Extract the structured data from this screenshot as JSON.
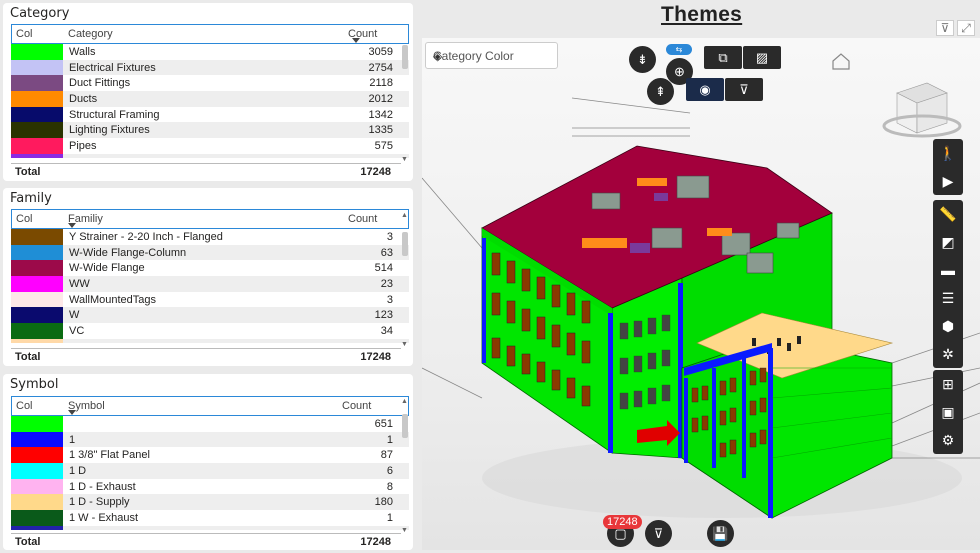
{
  "category": {
    "title": "Category",
    "headers": {
      "col": "Col",
      "name": "Category",
      "count": "Count"
    },
    "rows": [
      {
        "color": "#00ff00",
        "name": "Walls",
        "count": "3059"
      },
      {
        "color": "#c3c3f5",
        "name": "Electrical Fixtures",
        "count": "2754"
      },
      {
        "color": "#7b4a82",
        "name": "Duct Fittings",
        "count": "2118"
      },
      {
        "color": "#ff8a00",
        "name": "Ducts",
        "count": "2012"
      },
      {
        "color": "#070b6b",
        "name": "Structural Framing",
        "count": "1342"
      },
      {
        "color": "#2a3300",
        "name": "Lighting Fixtures",
        "count": "1335"
      },
      {
        "color": "#ff1a5e",
        "name": "Pipes",
        "count": "575"
      },
      {
        "color": "#8a2be2",
        "name": "",
        "count": ""
      }
    ],
    "total_label": "Total",
    "total": "17248"
  },
  "family": {
    "title": "Family",
    "headers": {
      "col": "Col",
      "name": "Familiy",
      "count": "Count"
    },
    "rows": [
      {
        "color": "#7a4a00",
        "name": "Y Strainer - 2-20 Inch - Flanged",
        "count": "3"
      },
      {
        "color": "#1f8ed6",
        "name": "W-Wide Flange-Column",
        "count": "63"
      },
      {
        "color": "#9c0a4a",
        "name": "W-Wide Flange",
        "count": "514"
      },
      {
        "color": "#ff00ff",
        "name": "WW",
        "count": "23"
      },
      {
        "color": "#fde8e8",
        "name": "WallMountedTags",
        "count": "3"
      },
      {
        "color": "#0a0a6e",
        "name": "W",
        "count": "123"
      },
      {
        "color": "#0a6b12",
        "name": "VC",
        "count": "34"
      },
      {
        "color": "#ffd9a8",
        "name": "",
        "count": ""
      }
    ],
    "total_label": "Total",
    "total": "17248"
  },
  "symbol": {
    "title": "Symbol",
    "headers": {
      "col": "Col",
      "name": "Symbol",
      "count": "Count"
    },
    "rows": [
      {
        "color": "#00ff00",
        "name": "",
        "count": "651"
      },
      {
        "color": "#0a0aff",
        "name": "1",
        "count": "1"
      },
      {
        "color": "#ff0000",
        "name": "1 3/8\" Flat Panel",
        "count": "87"
      },
      {
        "color": "#00ffff",
        "name": "1 D",
        "count": "6"
      },
      {
        "color": "#ffb3f0",
        "name": "1 D - Exhaust",
        "count": "8"
      },
      {
        "color": "#ffd98a",
        "name": "1 D - Supply",
        "count": "180"
      },
      {
        "color": "#0a5a1a",
        "name": "1 W - Exhaust",
        "count": "1"
      },
      {
        "color": "#2222aa",
        "name": "",
        "count": ""
      }
    ],
    "total_label": "Total",
    "total": "17248"
  },
  "viewer": {
    "title": "Themes",
    "dropdown_value": "Category Color",
    "badge_count": "17248"
  }
}
